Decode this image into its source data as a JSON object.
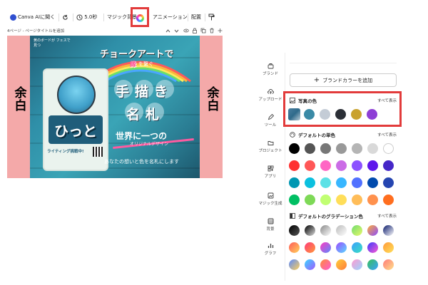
{
  "toolbar": {
    "open_in_canva_ai": "Canva AIに聞く",
    "duration": "5.0秒",
    "magic_background": "マジック背景",
    "animation": "アニメーション",
    "position": "配置"
  },
  "subbar": {
    "page_label": "4ページ - ページタイトルを追加"
  },
  "canvas": {
    "left_label": "余白",
    "right_label": "余白",
    "design_title": "チョークアートで",
    "design_subtitle_1": "縁",
    "design_subtitle_2": "を繋ぐ",
    "big_text_1": "手描き",
    "big_text_2": "名札",
    "tagline_1": "世界に一つの",
    "tagline_2": "オリジナルデザイン",
    "tagline_3": "あなたの想いと色を名札にします",
    "badge_name": "ひっと",
    "badge_sub": "ライティング挑戦中!",
    "top_note": "黄のボードが フェスで見つ"
  },
  "rail": {
    "items": [
      "ブランド",
      "アップロード",
      "ツール",
      "プロジェクト",
      "アプリ",
      "マジック生成",
      "背景",
      "グラフ"
    ]
  },
  "panel": {
    "add_brand_color": "ブランドカラーを追加",
    "photo_colors_title": "写真の色",
    "show_all_1": "すべて表示",
    "solid_colors_title": "デフォルトの単色",
    "show_all_2": "すべて表示",
    "gradient_title": "デフォルトのグラデーション色",
    "show_all_3": "すべて表示",
    "photo_colors": [
      "#3a8aa6",
      "#c4ccd6",
      "#2b2f36",
      "#c9a22f",
      "#8e3fd6"
    ],
    "solid_rows": [
      [
        "#000000",
        "#555555",
        "#777777",
        "#999999",
        "#b5b5b5",
        "#d9d9d9",
        "#ffffff"
      ],
      [
        "#ff3131",
        "#ff5757",
        "#ff66c4",
        "#cb6ce6",
        "#8c52ff",
        "#5e17eb",
        "#4527c8"
      ],
      [
        "#0097b2",
        "#0cc0df",
        "#5ce1e6",
        "#38b6ff",
        "#5271ff",
        "#004aad",
        "#2545b0"
      ],
      [
        "#00bf63",
        "#7ed957",
        "#c1ff72",
        "#ffde59",
        "#ffbd59",
        "#ff914d",
        "#ff6e1f"
      ]
    ],
    "accent_red": "#e23b3b"
  }
}
